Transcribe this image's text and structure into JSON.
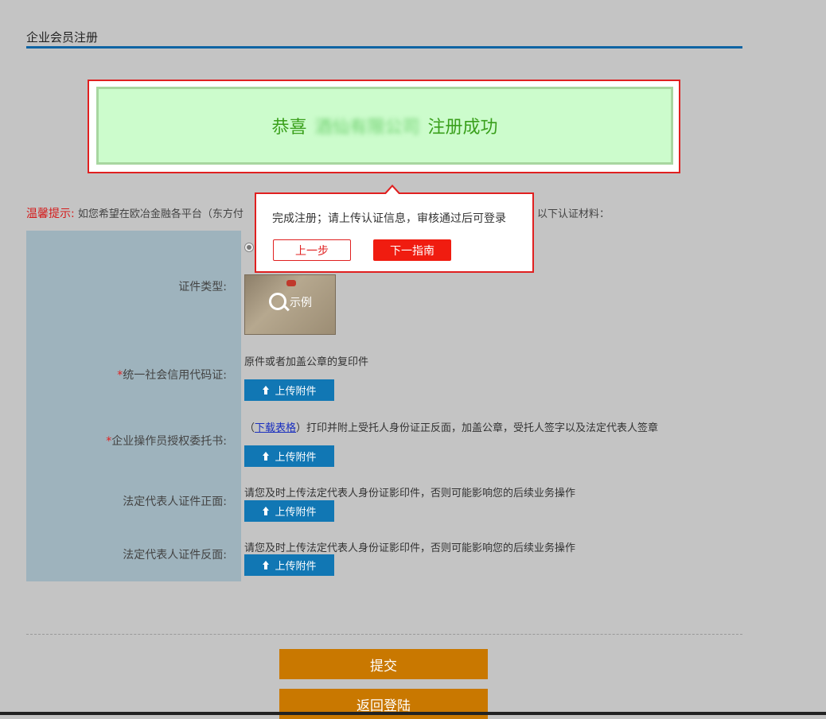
{
  "page": {
    "title": "企业会员注册"
  },
  "success": {
    "prefix": "恭喜",
    "company": "酒仙有限公司",
    "suffix": "注册成功"
  },
  "tip": {
    "label": "温馨提示:",
    "text": "如您希望在欧冶金融各平台（东方付",
    "tail": "以下认证材料："
  },
  "form": {
    "cert_type_label": "证件类型:",
    "sample_label": "示例",
    "credit_code": {
      "required_mark": "*",
      "label": "统一社会信用代码证:",
      "hint": "原件或者加盖公章的复印件",
      "upload_label": "上传附件"
    },
    "authorization": {
      "required_mark": "*",
      "label": "企业操作员授权委托书:",
      "hint_open": "（",
      "download_link": "下载表格",
      "hint_rest": "）打印并附上受托人身份证正反面，加盖公章，受托人签字以及法定代表人签章",
      "upload_label": "上传附件"
    },
    "legal_front": {
      "label": "法定代表人证件正面:",
      "hint": "请您及时上传法定代表人身份证影印件，否则可能影响您的后续业务操作",
      "upload_label": "上传附件"
    },
    "legal_back": {
      "label": "法定代表人证件反面:",
      "hint": "请您及时上传法定代表人身份证影印件，否则可能影响您的后续业务操作",
      "upload_label": "上传附件"
    }
  },
  "actions": {
    "submit": "提交",
    "back_login": "返回登陆"
  },
  "popover": {
    "message": "完成注册；请上传认证信息，审核通过后可登录",
    "prev": "上一步",
    "next": "下一指南"
  },
  "colors": {
    "accent_blue": "#0f64a3",
    "upload_blue": "#1177b4",
    "success_green": "#3aa01c",
    "alert_red": "#e02020",
    "action_orange": "#c97800",
    "panel_gray_blue": "#9eb3bd"
  },
  "icons": {
    "upload": "upload-icon",
    "zoom": "magnifier-icon"
  }
}
